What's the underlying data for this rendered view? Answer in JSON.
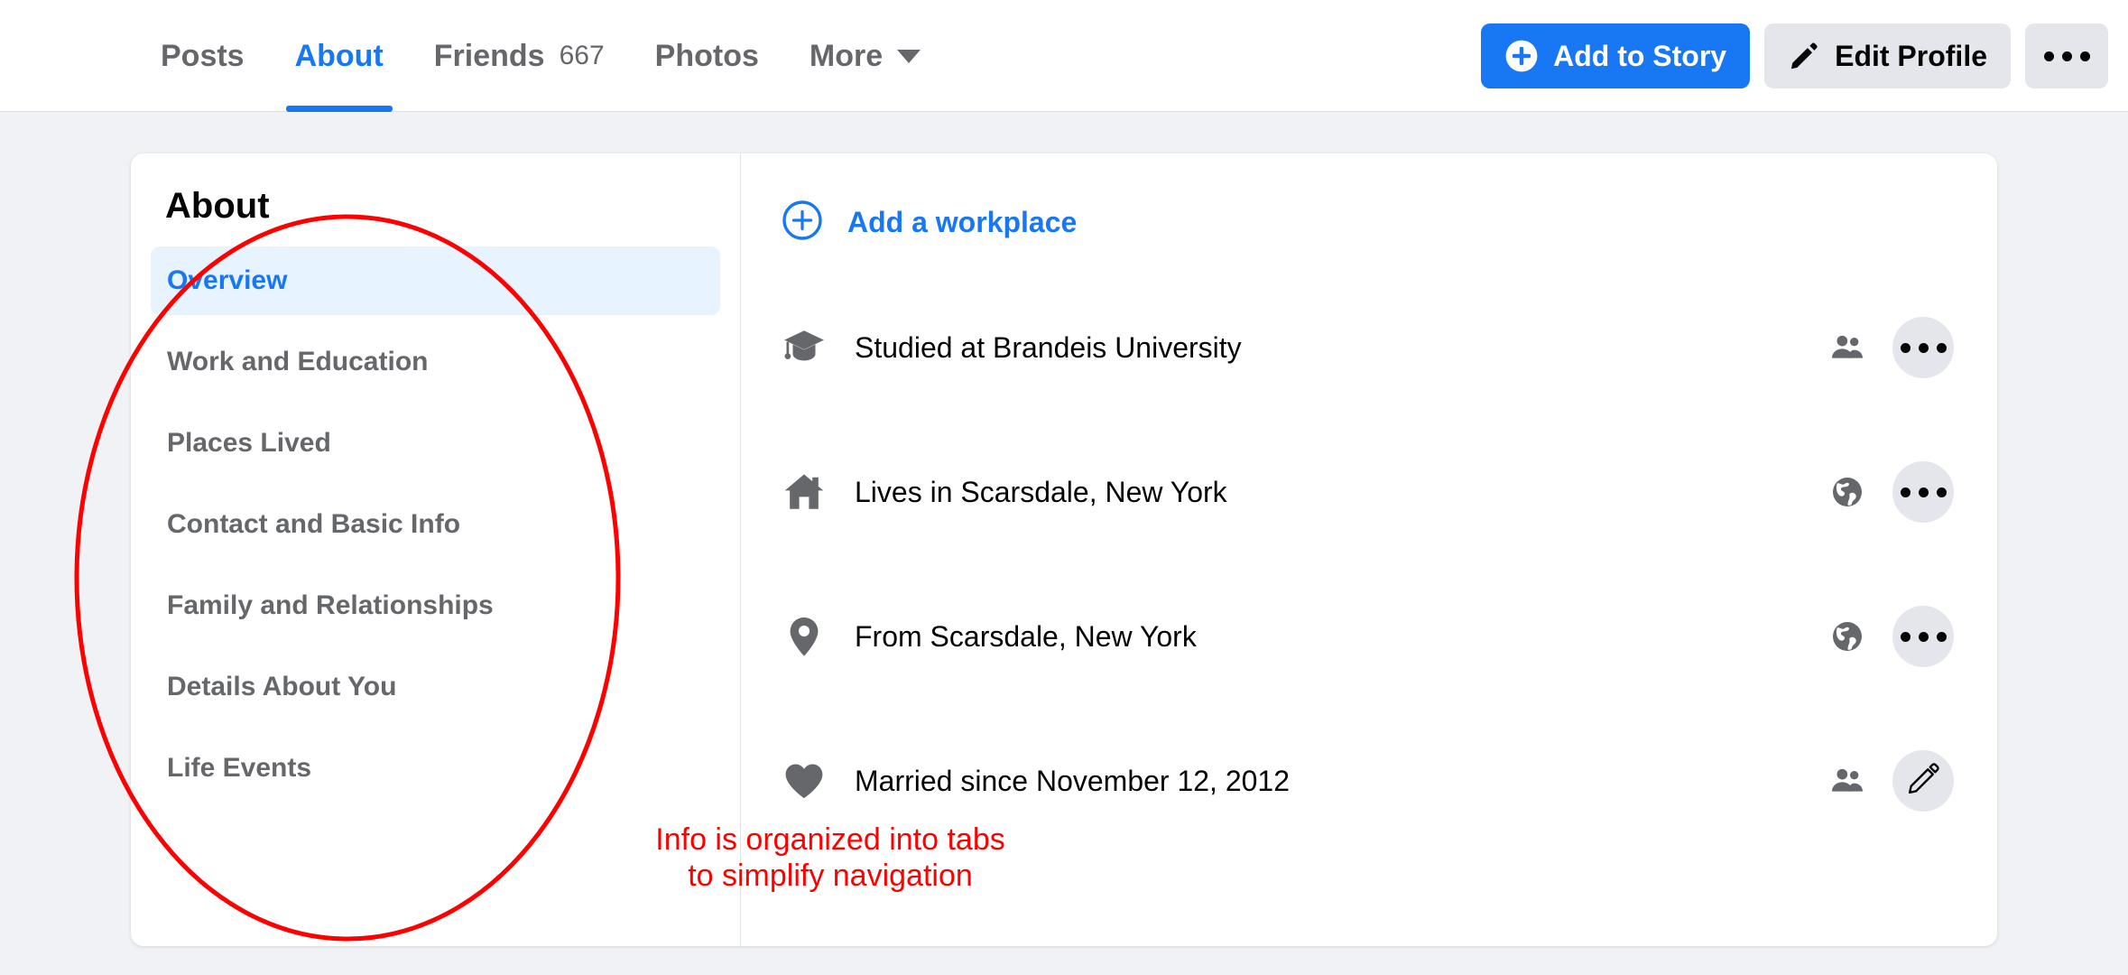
{
  "topnav": {
    "tabs": [
      {
        "label": "Posts",
        "count": "",
        "active": false,
        "caret": false
      },
      {
        "label": "About",
        "count": "",
        "active": true,
        "caret": false
      },
      {
        "label": "Friends",
        "count": "667",
        "active": false,
        "caret": false
      },
      {
        "label": "Photos",
        "count": "",
        "active": false,
        "caret": false
      },
      {
        "label": "More",
        "count": "",
        "active": false,
        "caret": true
      }
    ],
    "actions": {
      "add_story_label": "Add to Story",
      "add_story_icon": "plus-circle-icon",
      "edit_profile_label": "Edit Profile",
      "edit_profile_icon": "pencil-icon",
      "more_icon": "ellipsis-icon"
    }
  },
  "about": {
    "title": "About",
    "menu": [
      {
        "label": "Overview",
        "active": true
      },
      {
        "label": "Work and Education",
        "active": false
      },
      {
        "label": "Places Lived",
        "active": false
      },
      {
        "label": "Contact and Basic Info",
        "active": false
      },
      {
        "label": "Family and Relationships",
        "active": false
      },
      {
        "label": "Details About You",
        "active": false
      },
      {
        "label": "Life Events",
        "active": false
      }
    ],
    "add_action": {
      "label": "Add a workplace",
      "icon": "plus-circle-outline-icon"
    },
    "rows": [
      {
        "icon": "graduation-cap-icon",
        "text": "Studied at Brandeis University",
        "privacy_icon": "friends-icon",
        "action_icon": "ellipsis-icon"
      },
      {
        "icon": "home-icon",
        "text": "Lives in Scarsdale, New York",
        "privacy_icon": "globe-icon",
        "action_icon": "ellipsis-icon"
      },
      {
        "icon": "map-pin-icon",
        "text": "From Scarsdale, New York",
        "privacy_icon": "globe-icon",
        "action_icon": "ellipsis-icon"
      },
      {
        "icon": "heart-icon",
        "text": "Married since November 12, 2012",
        "privacy_icon": "friends-icon",
        "action_icon": "pencil-icon"
      }
    ]
  },
  "annotations": {
    "callout_text": "Info is organized into tabs\nto simplify navigation",
    "callout_color": "#ff0000",
    "ellipse_color": "#ff0000"
  },
  "colors": {
    "accent_blue": "#1877f2",
    "active_pill": "#e7f3ff",
    "page_bg": "#f0f2f5",
    "card_bg": "#ffffff",
    "muted_text": "#65676b",
    "primary_text": "#050505",
    "button_grey": "#e4e6eb",
    "icon_grey": "#65676b"
  }
}
